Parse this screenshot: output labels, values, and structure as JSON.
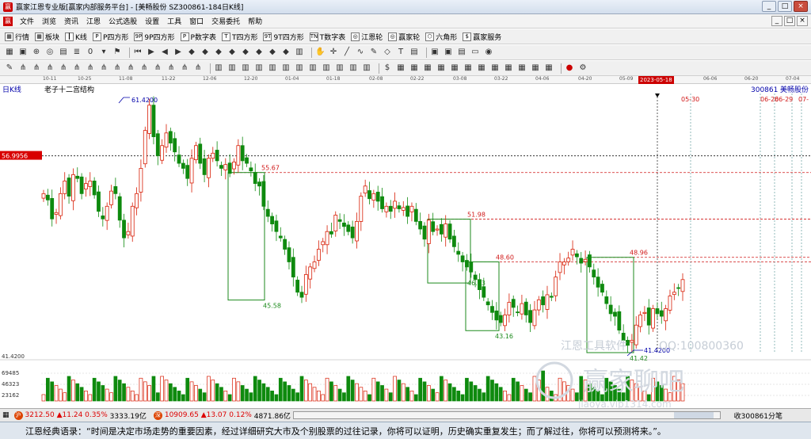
{
  "window": {
    "title": "赢家江恩专业版[赢家内部服务平台] - [美畅股份 SZ300861-184日K线]",
    "controls": [
      "_",
      "□",
      "×"
    ]
  },
  "menu": {
    "items": [
      "文件",
      "浏览",
      "资讯",
      "江恩",
      "公式选股",
      "设置",
      "工具",
      "窗口",
      "交易委托",
      "帮助"
    ],
    "right_controls": [
      "_",
      "□",
      "×"
    ]
  },
  "toolbar1": {
    "items": [
      {
        "label": "行情",
        "icon": "grid-icon"
      },
      {
        "label": "板块",
        "icon": "grid-icon"
      },
      {
        "label": "K线",
        "icon": "kline-icon"
      },
      {
        "label": "P四方形",
        "icon": "square-p-icon",
        "tag": "P"
      },
      {
        "label": "9P四方形",
        "icon": "square-9p-icon",
        "tag": "9P"
      },
      {
        "label": "P数字表",
        "icon": "number-table-icon",
        "tag": "P"
      },
      {
        "label": "T四方形",
        "icon": "square-t-icon",
        "tag": "T"
      },
      {
        "label": "9T四方形",
        "icon": "square-9t-icon",
        "tag": "9T"
      },
      {
        "label": "T数字表",
        "icon": "number-table-icon",
        "tag": "TN"
      },
      {
        "label": "江恩轮",
        "icon": "wheel-icon"
      },
      {
        "label": "赢家轮",
        "icon": "wheel-icon"
      },
      {
        "label": "六角形",
        "icon": "hexagon-icon"
      },
      {
        "label": "赢家服务",
        "icon": "dollar-icon",
        "tag": "$"
      }
    ]
  },
  "chart": {
    "period_label": "日K线",
    "indicator_title": "老子十二宫结构",
    "stock_code": "300861",
    "stock_name": "美畅股份",
    "price_marker": "56.9956",
    "highlight_date": "2023-05-18",
    "top_dates": [
      "10-11",
      "10-25",
      "11-08",
      "11-22",
      "12-06",
      "12-20",
      "01-04",
      "01-18",
      "02-08",
      "02-22",
      "03-08",
      "03-22",
      "04-06",
      "04-20",
      "05-09",
      "06-06",
      "06-20",
      "07-04"
    ],
    "future_dates": [
      "05-30",
      "06-26",
      "06-29",
      "07-"
    ],
    "annotations": [
      "61.4200",
      "55.67",
      "51.98",
      "48.60",
      "48.96",
      "45.58",
      "46.93",
      "43.16",
      "41.4200",
      "41.42"
    ],
    "axis_values": [
      "41.4200",
      "69485",
      "46323",
      "23162"
    ],
    "watermark_1": "江恩工具软件",
    "watermark_qq": "QQ:100800360",
    "watermark_2": "赢家聊吧",
    "watermark_url": "jiaoya.vip1314.com"
  },
  "status": {
    "sh_index": "3212.50",
    "sh_change": "▲11.24",
    "sh_pct": "0.35%",
    "sh_amount": "3333.19亿",
    "sz_index": "10909.65",
    "sz_change": "▲13.07",
    "sz_pct": "0.12%",
    "sz_amount": "4871.86亿",
    "ticker": "收300861分笔"
  },
  "quote": {
    "text": "江恩经典语录：“时间是决定市场走势的重要因素，经过详细研究大市及个别股票的过往记录，你将可以证明，历史确实重复发生；而了解过往，你将可以预测将来。”。"
  },
  "colors": {
    "up": "#d81e06",
    "down": "#0e8a0e",
    "box": "#1c8a1c",
    "level": "#d01818"
  }
}
